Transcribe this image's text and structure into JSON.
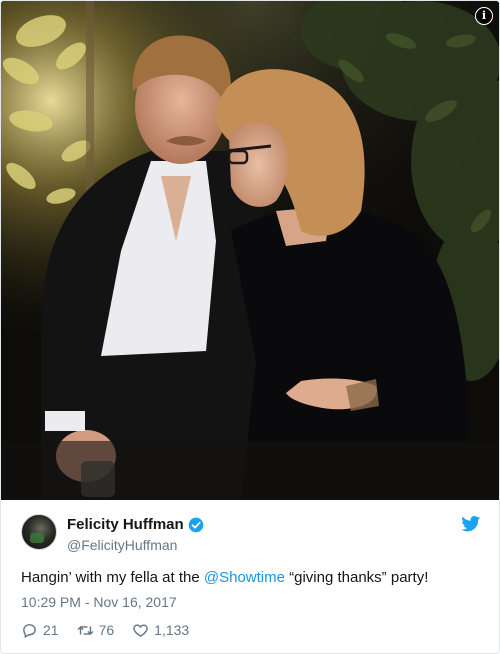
{
  "info_label": "i",
  "tweet": {
    "display_name": "Felicity Huffman",
    "handle": "@FelicityHuffman",
    "text_before": "Hangin’ with my fella at the ",
    "mention": "@Showtime",
    "text_after": " “giving thanks” party!",
    "timestamp": "10:29 PM - Nov 16, 2017"
  },
  "actions": {
    "replies": "21",
    "retweets": "76",
    "likes": "1,133"
  },
  "colors": {
    "link": "#1b95e0",
    "meta": "#657786",
    "text": "#14171a",
    "verified": "#1da1f2"
  },
  "icons": [
    "info-icon",
    "verified-icon",
    "twitter-bird-icon",
    "reply-icon",
    "retweet-icon",
    "like-icon"
  ]
}
